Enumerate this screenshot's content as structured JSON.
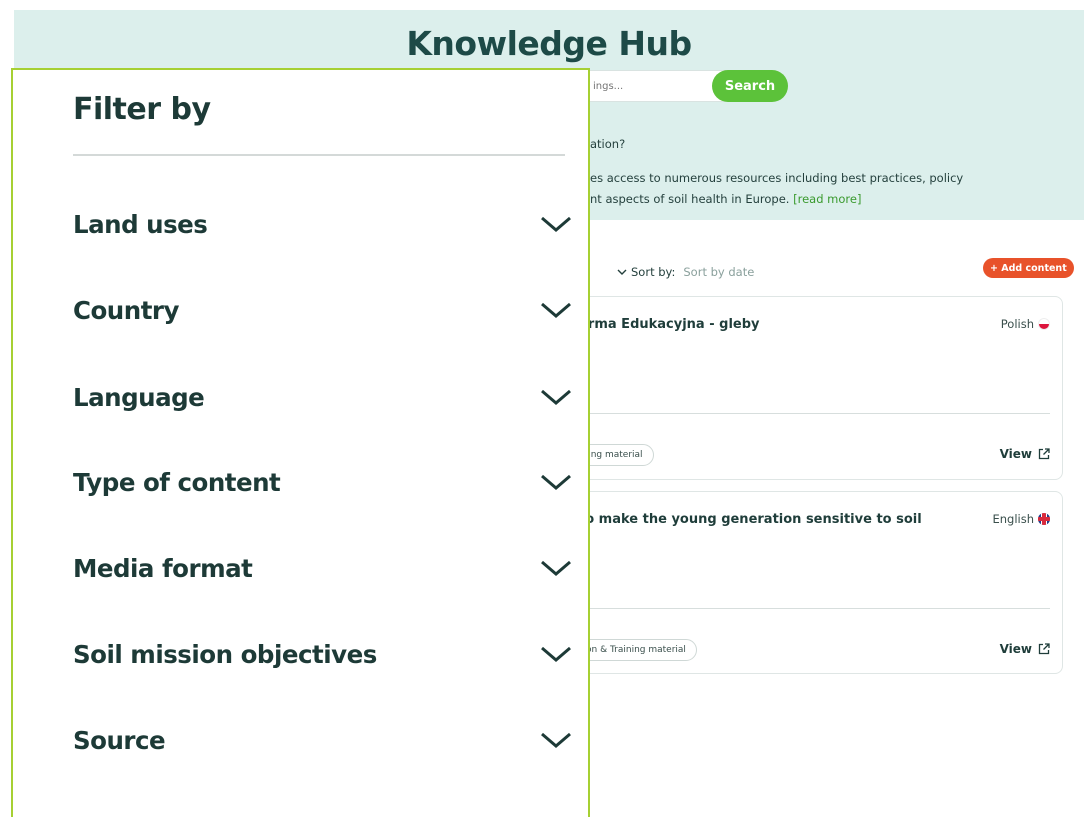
{
  "header": {
    "title": "Knowledge Hub",
    "search_placeholder": "ings...",
    "search_button": "Search",
    "intro_question": "ation?",
    "intro_line1": "es access to numerous resources including best practices, policy",
    "intro_line2": "nt aspects of soil health in Europe. ",
    "read_more": "[read more]"
  },
  "sort": {
    "label": "Sort by:",
    "value": "Sort by date",
    "icon": "chevron-down-icon"
  },
  "add_content_label": "+ Add content",
  "cards": [
    {
      "title": "orma Edukacyjna - gleby",
      "language": "Polish",
      "tag": "ining material",
      "view_label": "View"
    },
    {
      "title": "to make the young generation sensitive to soil",
      "language": "English",
      "tag": "tion & Training material",
      "view_label": "View"
    }
  ],
  "filter": {
    "title": "Filter by",
    "items": [
      {
        "label": "Land uses"
      },
      {
        "label": "Country"
      },
      {
        "label": "Language"
      },
      {
        "label": "Type of content"
      },
      {
        "label": "Media format"
      },
      {
        "label": "Soil mission objectives"
      },
      {
        "label": "Source"
      }
    ]
  },
  "colors": {
    "header_bg": "#dcefec",
    "search_green": "#5cc23a",
    "add_content_orange": "#e8522a",
    "panel_border": "#a6d033",
    "heading": "#1d3a37"
  }
}
